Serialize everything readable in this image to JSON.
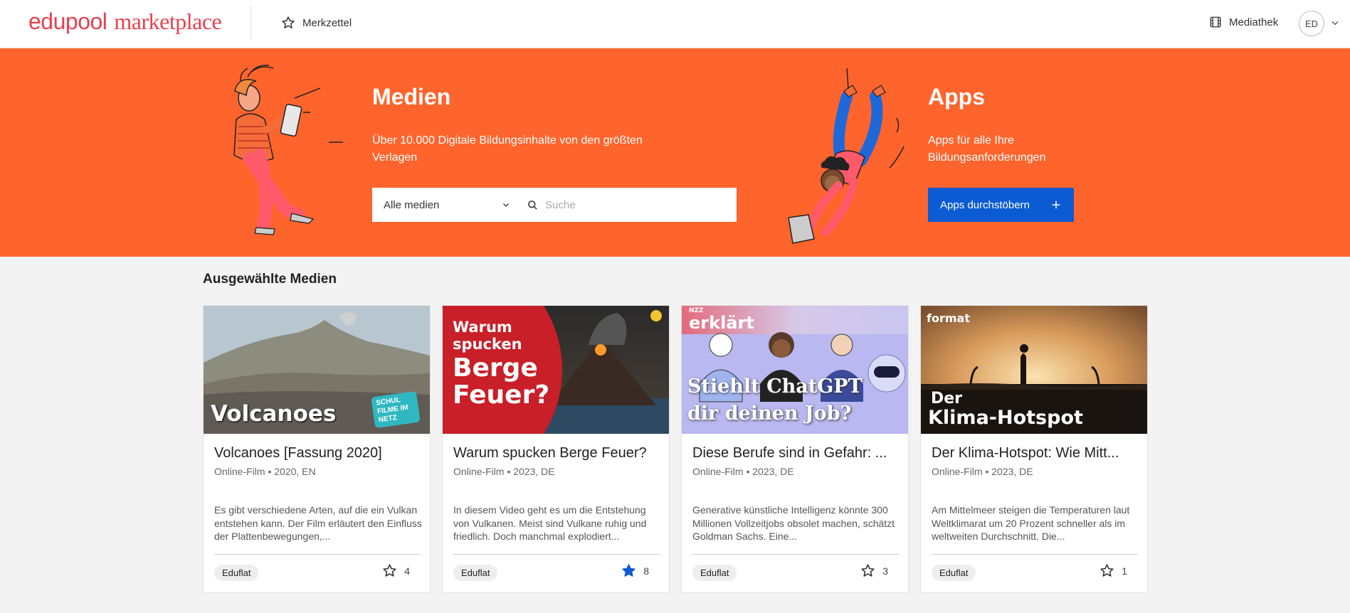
{
  "header": {
    "logo_part1": "edupool",
    "logo_part2": "marketplace",
    "bookmarks_label": "Merkzettel",
    "mediathek_label": "Mediathek",
    "avatar_initials": "ED"
  },
  "hero": {
    "media": {
      "title": "Medien",
      "description": "Über 10.000 Digitale Bildungsinhalte von den größten Verlagen",
      "filter_selected": "Alle medien",
      "search_placeholder": "Suche"
    },
    "apps": {
      "title": "Apps",
      "description": "Apps für alle Ihre Bildungsanforderungen",
      "button_label": "Apps durchstöbern"
    }
  },
  "featured": {
    "title": "Ausgewählte Medien",
    "cards": [
      {
        "thumb_text": "Volcanoes",
        "badge_text": "SCHUL FILME IM NETZ",
        "title": "Volcanoes [Fassung 2020]",
        "meta": "Online-Film • 2020, EN",
        "description": "Es gibt verschiedene Arten, auf die ein Vulkan entstehen kann. Der Film erläutert den Einfluss der Plattenbewegungen,...",
        "tag": "Eduflat",
        "favorited": false,
        "fav_count": "4"
      },
      {
        "thumb_line1": "Warum",
        "thumb_line2": "spucken",
        "thumb_line3": "Berge",
        "thumb_line4": "Feuer?",
        "title": "Warum spucken Berge Feuer?",
        "meta": "Online-Film • 2023, DE",
        "description": "In diesem Video geht es um die Entstehung von Vulkanen. Meist sind Vulkane ruhig und friedlich. Doch manchmal explodiert...",
        "tag": "Eduflat",
        "favorited": true,
        "fav_count": "8"
      },
      {
        "thumb_brand_small": "NZZ",
        "thumb_brand": "erklärt",
        "thumb_line1": "Stiehlt ChatGPT",
        "thumb_line2": "dir deinen Job?",
        "title": "Diese Berufe sind in Gefahr: ...",
        "meta": "Online-Film • 2023, DE",
        "description": "Generative künstliche Intelligenz könnte 300 Millionen Vollzeitjobs obsolet machen, schätzt Goldman Sachs. Eine...",
        "tag": "Eduflat",
        "favorited": false,
        "fav_count": "3"
      },
      {
        "thumb_brand": "format",
        "thumb_line1": "Der",
        "thumb_line2": "Klima-Hotspot",
        "title": "Der Klima-Hotspot: Wie Mitt...",
        "meta": "Online-Film • 2023, DE",
        "description": "Am Mittelmeer steigen die Temperaturen laut Weltklimarat um 20 Prozent schneller als im weltweiten Durchschnitt. Die...",
        "tag": "Eduflat",
        "favorited": false,
        "fav_count": "1"
      }
    ]
  },
  "colors": {
    "brand_red": "#e8414f",
    "hero_orange": "#ff642c",
    "primary_blue": "#0b5bd3",
    "star_blue": "#0b5bd3"
  }
}
